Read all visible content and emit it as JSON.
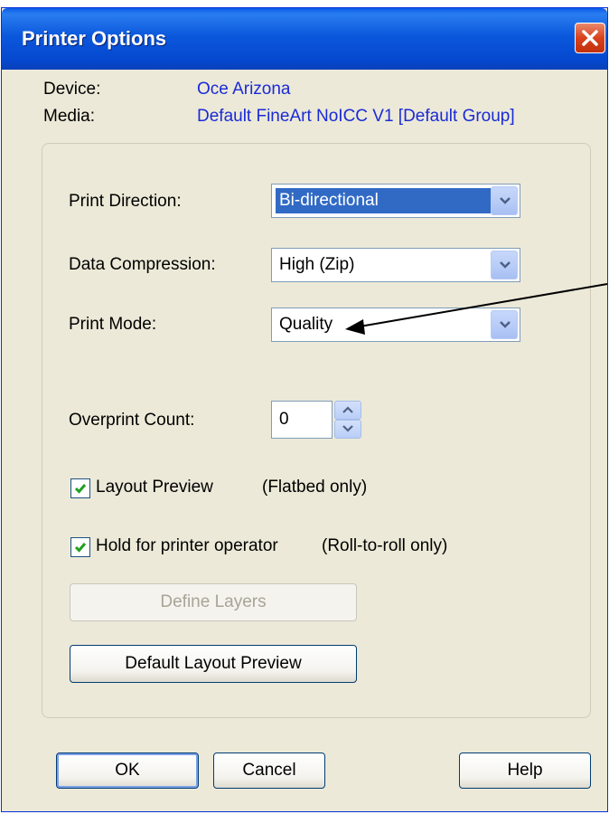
{
  "window": {
    "title": "Printer Options"
  },
  "info": {
    "device_label": "Device:",
    "device_value": "Oce Arizona",
    "media_label": "Media:",
    "media_value": "Default FineArt NoICC V1 [Default Group]"
  },
  "fields": {
    "print_direction": {
      "label": "Print Direction:",
      "value": "Bi-directional"
    },
    "data_compression": {
      "label": "Data Compression:",
      "value": "High (Zip)"
    },
    "print_mode": {
      "label": "Print Mode:",
      "value": "Quality"
    },
    "overprint_count": {
      "label": "Overprint Count:",
      "value": "0"
    }
  },
  "checkboxes": {
    "layout_preview": {
      "label": "Layout Preview",
      "note": "(Flatbed only)",
      "checked": true
    },
    "hold_for_operator": {
      "label": "Hold for printer operator",
      "note": "(Roll-to-roll only)",
      "checked": true
    }
  },
  "buttons": {
    "define_layers": "Define Layers",
    "default_layout_preview": "Default Layout Preview",
    "ok": "OK",
    "cancel": "Cancel",
    "help": "Help"
  },
  "colors": {
    "title_bar": "#0a5ce8",
    "link_blue": "#1a2bd6",
    "selection": "#316ac5",
    "dialog_bg": "#ece9d8"
  }
}
